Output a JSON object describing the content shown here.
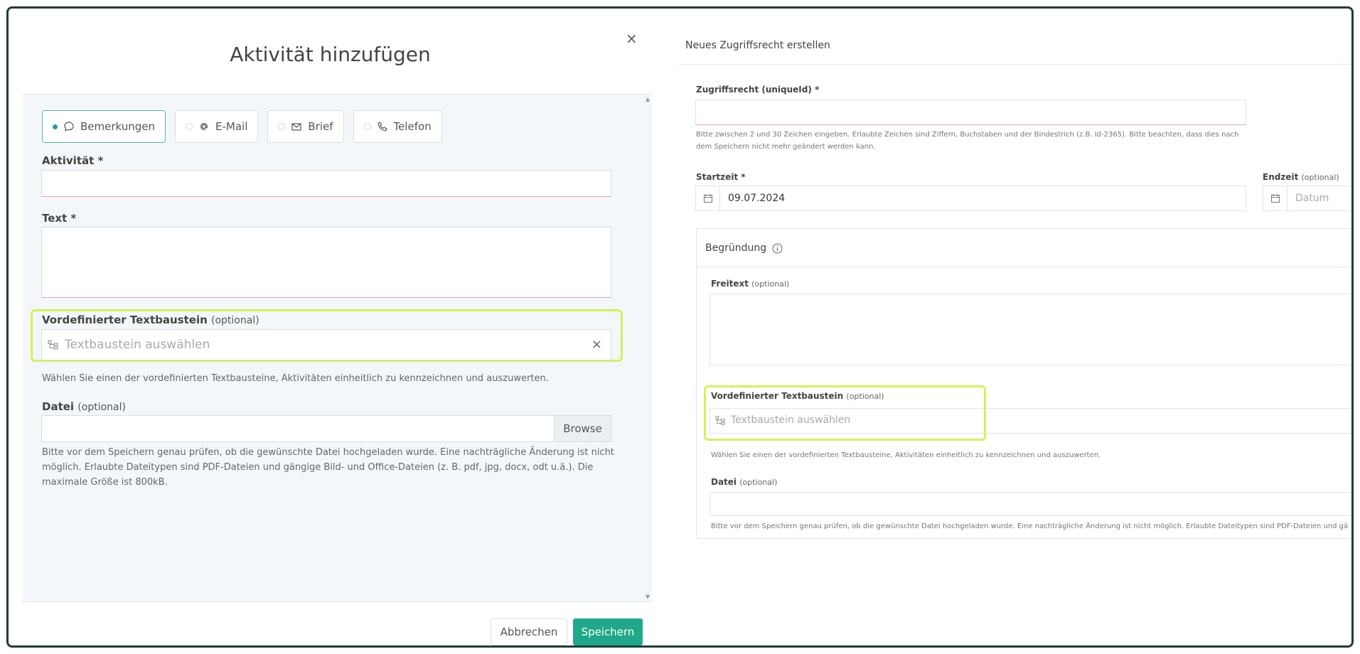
{
  "left_modal": {
    "title": "Aktivität hinzufügen",
    "close_glyph": "×",
    "tabs": [
      {
        "label": "Bemerkungen",
        "icon": "speech-bubble-icon",
        "selected": true
      },
      {
        "label": "E-Mail",
        "icon": "at-icon",
        "selected": false
      },
      {
        "label": "Brief",
        "icon": "envelope-icon",
        "selected": false
      },
      {
        "label": "Telefon",
        "icon": "phone-icon",
        "selected": false
      }
    ],
    "aktivitaet_label": "Aktivität *",
    "aktivitaet_value": "",
    "text_label": "Text *",
    "text_value": "",
    "textbaustein_label": "Vordefinierter Textbaustein",
    "optional": "(optional)",
    "textbaustein_placeholder": "Textbaustein auswählen",
    "textbaustein_clear": "×",
    "textbaustein_hint": "Wählen Sie einen der vordefinierten Textbausteine, Aktivitäten einheitlich zu kennzeichnen und auszuwerten.",
    "datei_label": "Datei",
    "browse_label": "Browse",
    "datei_hint": "Bitte vor dem Speichern genau prüfen, ob die gewünschte Datei hochgeladen wurde. Eine nachträgliche Änderung ist nicht möglich. Erlaubte Dateitypen sind PDF-Dateien und gängige Bild- und Office-Dateien (z. B. pdf, jpg, docx, odt u.ä.). Die maximale Größe ist 800kB.",
    "cancel_label": "Abbrechen",
    "save_label": "Speichern"
  },
  "right_panel": {
    "title": "Neues Zugriffsrecht erstellen",
    "zugriffsrecht_label": "Zugriffsrecht (uniqueId) *",
    "zugriffsrecht_value": "",
    "zugriffsrecht_hint": "Bitte zwischen 2 und 30 Zeichen eingeben. Erlaubte Zeichen sind Ziffern, Buchstaben und der Bindestrich (z.B. Id-2365). Bitte beachten, dass dies nach dem Speichern nicht mehr geändert werden kann.",
    "startzeit_label": "Startzeit *",
    "startzeit_value": "09.07.2024",
    "endzeit_label": "Endzeit",
    "optional": "(optional)",
    "endzeit_placeholder": "Datum",
    "begruendung_title": "Begründung",
    "freitext_label": "Freitext",
    "freitext_value": "",
    "textbaustein_label": "Vordefinierter Textbaustein",
    "textbaustein_placeholder": "Textbaustein auswählen",
    "textbaustein_hint": "Wählen Sie einen der vordefinierten Textbausteine, Aktivitäten einheitlich zu kennzeichnen und auszuwerten.",
    "datei_label": "Datei",
    "datei_hint": "Bitte vor dem Speichern genau prüfen, ob die gewünschte Datei hochgeladen wurde. Eine nachträgliche Änderung ist nicht möglich. Erlaubte Dateitypen sind PDF-Dateien und gä"
  },
  "colors": {
    "accent": "#1fa88a",
    "highlight": "#d3f25a",
    "frame": "#1f3d35"
  }
}
